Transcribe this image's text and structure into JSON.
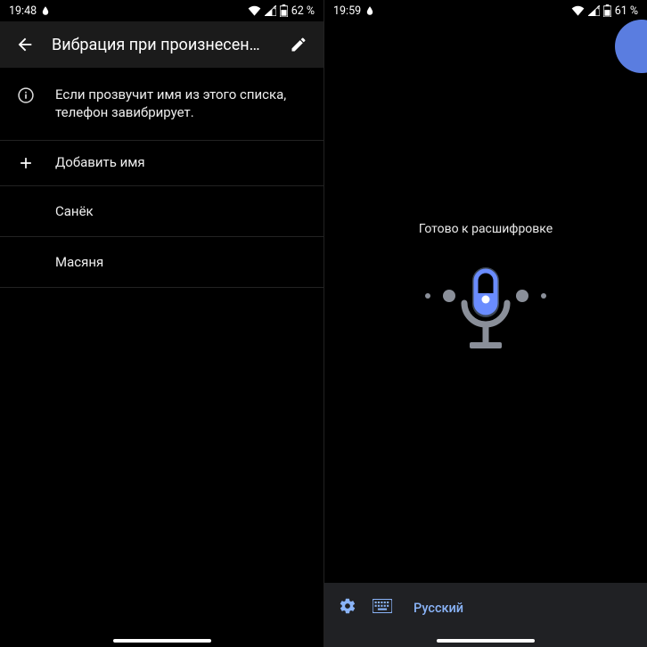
{
  "left": {
    "status": {
      "time": "19:48",
      "battery": "62 %"
    },
    "appbar": {
      "title": "Вибрация при произнесен…"
    },
    "info_text": "Если прозвучит имя из этого списка, телефон завибрирует.",
    "add_label": "Добавить имя",
    "names": [
      "Санёк",
      "Масяня"
    ]
  },
  "right": {
    "status": {
      "time": "19:59",
      "battery": "61 %"
    },
    "ready_text": "Готово к расшифровке",
    "bottombar": {
      "language": "Русский"
    }
  }
}
